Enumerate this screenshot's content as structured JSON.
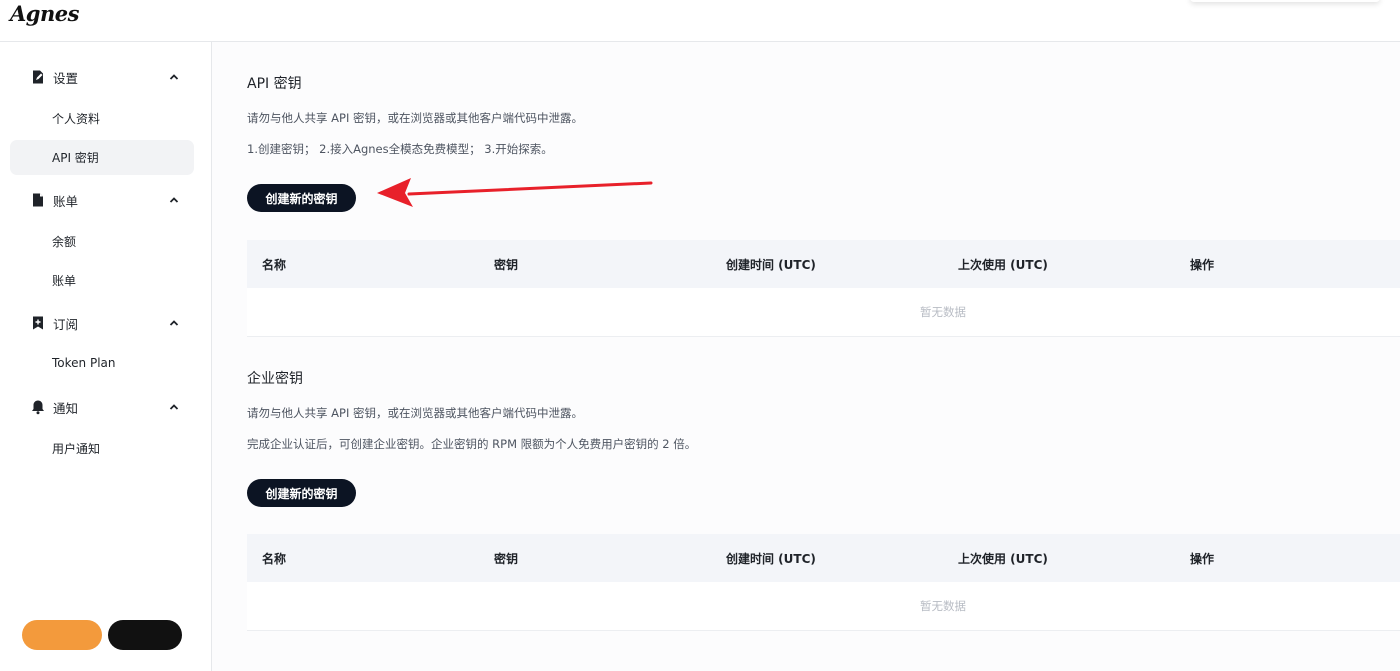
{
  "brand": {
    "logo_text": "Agnes"
  },
  "sidebar": {
    "groups": [
      {
        "label": "设置",
        "icon": "edit-doc-icon",
        "items": [
          "个人资料",
          "API 密钥"
        ]
      },
      {
        "label": "账单",
        "icon": "bill-doc-icon",
        "items": [
          "余额",
          "账单"
        ]
      },
      {
        "label": "订阅",
        "icon": "bookmark-plus-icon",
        "items": [
          "Token Plan"
        ]
      },
      {
        "label": "通知",
        "icon": "bell-icon",
        "items": [
          "用户通知"
        ]
      }
    ],
    "active_item": "API 密钥"
  },
  "api_section": {
    "title": "API 密钥",
    "desc1": "请勿与他人共享 API 密钥，或在浏览器或其他客户端代码中泄露。",
    "desc2": "1.创建密钥； 2.接入Agnes全模态免费模型； 3.开始探索。",
    "button_label": "创建新的密钥",
    "columns": [
      "名称",
      "密钥",
      "创建时间 (UTC)",
      "上次使用 (UTC)",
      "操作"
    ],
    "empty_text": "暂无数据"
  },
  "enterprise_section": {
    "title": "企业密钥",
    "desc1": "请勿与他人共享 API 密钥，或在浏览器或其他客户端代码中泄露。",
    "desc2": "完成企业认证后，可创建企业密钥。企业密钥的 RPM 限额为个人免费用户密钥的 2 倍。",
    "button_label": "创建新的密钥",
    "columns": [
      "名称",
      "密钥",
      "创建时间 (UTC)",
      "上次使用 (UTC)",
      "操作"
    ],
    "empty_text": "暂无数据"
  },
  "colors": {
    "primary_button": "#0c1423",
    "annotation_arrow": "#e8202a",
    "active_nav_bg": "#f2f3f5",
    "table_header_bg": "#f3f5f9"
  }
}
